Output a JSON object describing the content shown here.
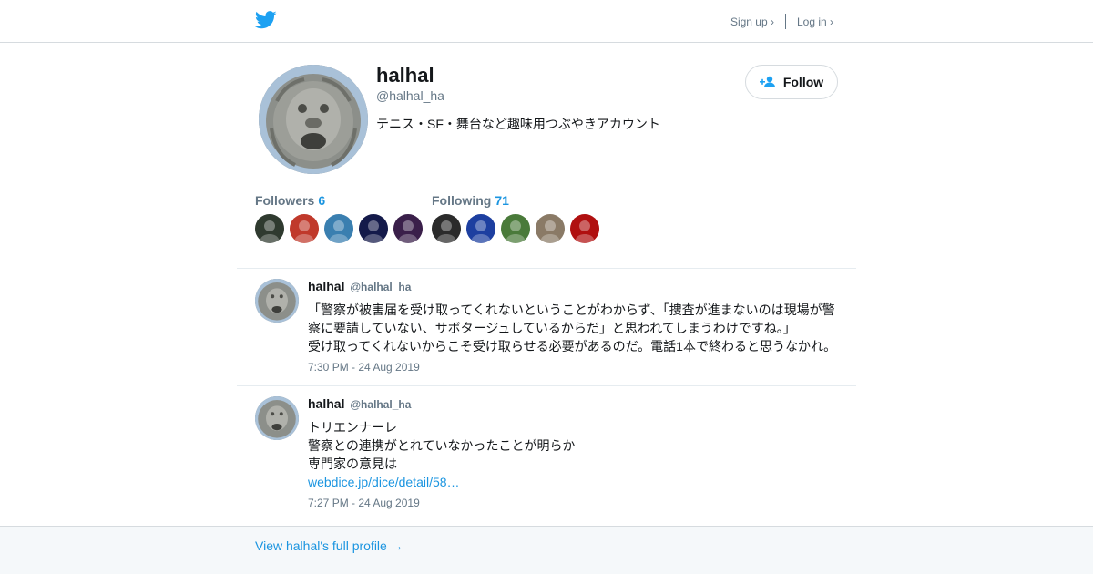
{
  "colors": {
    "brand": "#1da1f2",
    "link": "#1b95e0",
    "muted": "#657786",
    "border": "#d6dbdf"
  },
  "header": {
    "logo_icon": "twitter-bird-icon",
    "signup_label": "Sign up ›",
    "login_label": "Log in ›"
  },
  "profile": {
    "name": "halhal",
    "handle": "@halhal_ha",
    "bio": "テニス・SF・舞台など趣味用つぶやきアカウント",
    "follow_label": "Follow",
    "avatar_icon": "lion-statue-avatar"
  },
  "followers": {
    "label": "Followers",
    "count": "6",
    "avatars": [
      "#2f3a2f",
      "#c0392b",
      "#3a7fb0",
      "#141a4a",
      "#3a1f4a"
    ]
  },
  "following": {
    "label": "Following",
    "count": "71",
    "avatars": [
      "#2b2b2b",
      "#1d3fa0",
      "#4a7a3a",
      "#8a7a66",
      "#b01010"
    ]
  },
  "tweets": [
    {
      "name": "halhal",
      "handle": "@halhal_ha",
      "lines": [
        "「警察が被害届を受け取ってくれないということがわからず、「捜査が進まないのは現場が警",
        "察に要請していない、サボタージュしているからだ」と思われてしまうわけですね。」",
        "受け取ってくれないからこそ受け取らせる必要があるのだ。電話1本で終わると思うなかれ。"
      ],
      "link": "",
      "time": "7:30 PM - 24 Aug 2019"
    },
    {
      "name": "halhal",
      "handle": "@halhal_ha",
      "lines": [
        "トリエンナーレ",
        "警察との連携がとれていなかったことが明らか",
        "専門家の意見は"
      ],
      "link": "webdice.jp/dice/detail/58…",
      "time": "7:27 PM - 24 Aug 2019"
    }
  ],
  "footer": {
    "profile_link": "View halhal's full profile →"
  }
}
